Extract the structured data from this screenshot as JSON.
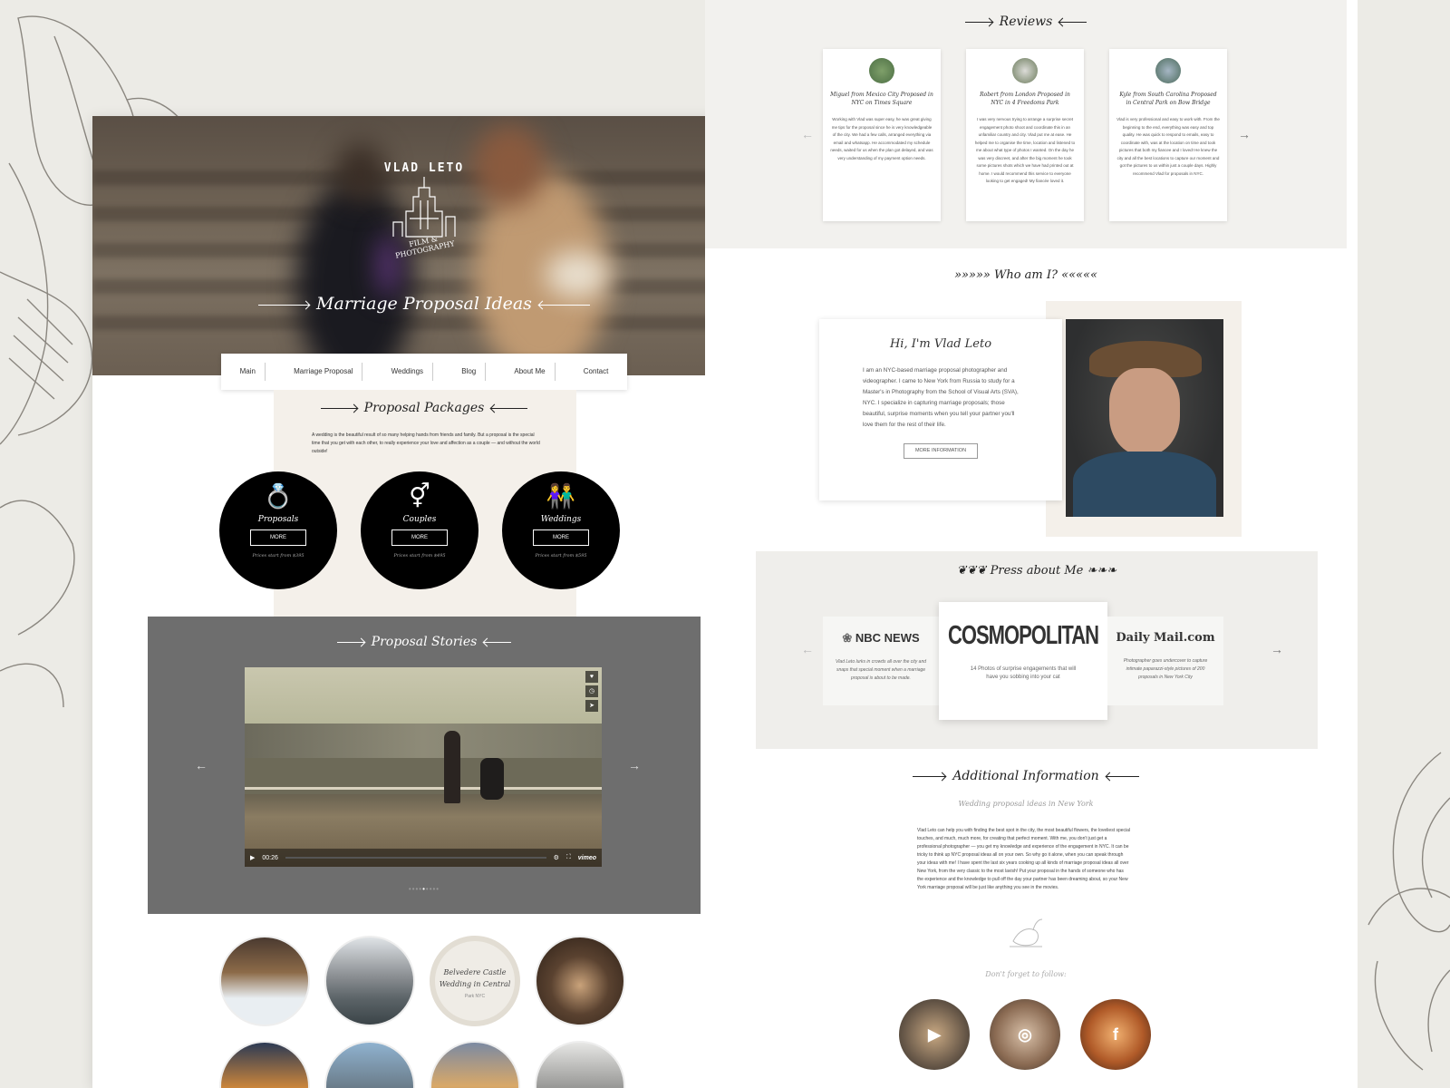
{
  "left": {
    "brand": {
      "line1": "VLAD LETO",
      "line2": "FILM & PHOTOGRAPHY"
    },
    "hero_title": "Marriage Proposal Ideas",
    "nav": [
      "Main",
      "Marriage Proposal",
      "Weddings",
      "Blog",
      "About Me",
      "Contact"
    ],
    "packages": {
      "title": "Proposal Packages",
      "description": "A wedding is the beautiful result of so many helping hands from friends and family. But a proposal is the special time that you get with each other, to really experience your love and affection as a couple — and without the world outside!",
      "items": [
        {
          "label": "Proposals",
          "button": "MORE",
          "price": "Prices start from $395"
        },
        {
          "label": "Couples",
          "button": "MORE",
          "price": "Prices start from $495"
        },
        {
          "label": "Weddings",
          "button": "MORE",
          "price": "Prices start from $595"
        }
      ]
    },
    "stories": {
      "title": "Proposal Stories",
      "video_time": "00:26",
      "video_brand": "vimeo"
    },
    "thumb_caption": {
      "line1": "Belvedere Castle",
      "line2": "Wedding in Central",
      "line3": "Park NYC"
    }
  },
  "right": {
    "reviews": {
      "title": "Reviews",
      "items": [
        {
          "title": "Miguel from Mexico City Proposed in NYC on Times Square",
          "body": "Working with Vlad was super easy, he was great giving me tips for the proposal since he is very knowledgeable of the city. We had a few calls, arranged everything via email and whatsapp. He accommodated my schedule needs, waited for us when the plan got delayed, and was very understanding of my payment option needs."
        },
        {
          "title": "Robert from London Proposed in NYC in 4 Freedoms Park",
          "body": "I was very nervous trying to arrange a surprise secret engagement photo shoot and coordinate this in an unfamiliar country and city. Vlad put me at ease. He helped me to organise the time, location and listened to me about what type of photos I wanted. On the day he was very discreet, and after the big moment he took some pictures shots which we have had printed out at home. I would recommend this service to everyone looking to get engaged! My fiancée loved it."
        },
        {
          "title": "Kyle from South Carolina Proposed in Central Park on Bow Bridge",
          "body": "Vlad is very professional and easy to work with. From the beginning to the end, everything was easy and top quality. He was quick to respond to emails, easy to coordinate with, was at the location on time and took pictures that both my fiancee and I loved! He knew the city and all the best locations to capture our moment and got the pictures to us within just a couple days. Highly recommend Vlad for proposals in NYC."
        }
      ]
    },
    "who": {
      "title": "Who am I?",
      "heading": "Hi, I'm Vlad Leto",
      "body": "I am an NYC-based marriage proposal photographer and videographer. I came to New York from Russia to study for a Master's in Photography from the School of Visual Arts (SVA), NYC. I specialize in capturing marriage proposals; those beautiful, surprise moments when you tell your partner you'll love them for the rest of their life.",
      "button": "MORE INFORMATION"
    },
    "press": {
      "title": "Press about Me",
      "items": [
        {
          "logo": "NBC NEWS",
          "text": "Vlad Leto lurks in crowds all over the city and snaps that special moment when a marriage proposal is about to be made."
        },
        {
          "logo": "COSMOPOLITAN",
          "text": "14 Photos of surprise engagements that will have you sobbing into your cat"
        },
        {
          "logo": "Daily Mail.com",
          "text": "Photographer goes undercover to capture intimate paparazzi-style pictures of 200 proposals in New York City"
        }
      ]
    },
    "additional": {
      "title": "Additional Information",
      "subtitle": "Wedding proposal ideas in New York",
      "body": "Vlad Leto can help you with finding the best spot in the city, the most beautiful flowers, the loveliest special touches, and much, much more, for creating that perfect moment. With me, you don't just get a professional photographer — you get my knowledge and experience of the engagement in NYC. It can be tricky to think up NYC proposal ideas all on your own. So why go it alone, when you can speak through your ideas with me! I have spent the last six years cooking up all kinds of marriage proposal ideas all over New York, from the very classic to the most lavish! Put your proposal in the hands of someone who has the experience and the knowledge to pull off the day your partner has been dreaming about, so your New York marriage proposal will be just like anything you see in the movies.",
      "follow": "Don't forget to follow:"
    },
    "socials": [
      "youtube-icon",
      "instagram-icon",
      "facebook-icon"
    ]
  }
}
